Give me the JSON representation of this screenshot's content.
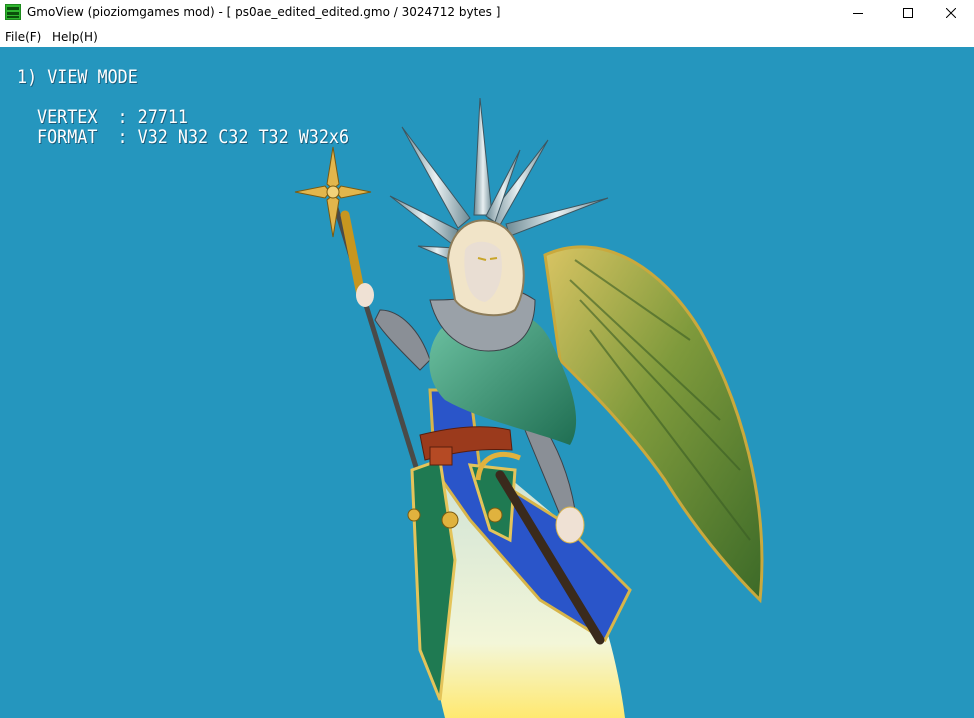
{
  "window": {
    "title": "GmoView (pioziomgames mod) - [ ps0ae_edited_edited.gmo / 3024712 bytes ]"
  },
  "menu": {
    "file": "File(F)",
    "help": "Help(H)"
  },
  "overlay": {
    "mode": "1) VIEW MODE",
    "vertex_line": "VERTEX  : 27711",
    "format_line": "FORMAT  : V32 N32 C32 T32 W32x6"
  },
  "colors": {
    "background": "#2596be",
    "overlay_text": "#ffffff"
  },
  "icons": {
    "app": "gmoview-app-icon",
    "minimize": "minimize-icon",
    "maximize": "maximize-icon",
    "close": "close-icon"
  }
}
